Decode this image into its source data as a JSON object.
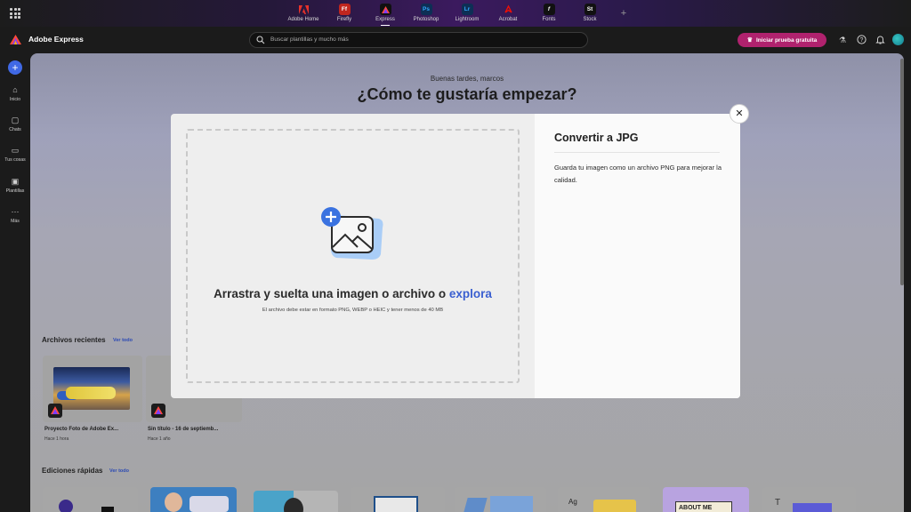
{
  "appbar": {
    "apps": [
      {
        "label": "Adobe Home",
        "tile": "",
        "color": "#1a1a1a"
      },
      {
        "label": "Firefly",
        "tile": "Ff",
        "color": "#c0261e"
      },
      {
        "label": "Express",
        "tile": "",
        "color": "#111111",
        "active": true
      },
      {
        "label": "Photoshop",
        "tile": "Ps",
        "color": "#0d2f55"
      },
      {
        "label": "Lightroom",
        "tile": "Lr",
        "color": "#0d2f55"
      },
      {
        "label": "Acrobat",
        "tile": "",
        "color": "#2a0a0a"
      },
      {
        "label": "Fonts",
        "tile": "f",
        "color": "#111111"
      },
      {
        "label": "Stock",
        "tile": "St",
        "color": "#111111"
      }
    ],
    "plus": "+"
  },
  "header": {
    "brand": "Adobe Express",
    "search_placeholder": "Buscar plantillas y mucho más",
    "trial_label": "Iniciar prueba gratuita",
    "icons": [
      "flask-icon",
      "help-icon",
      "bell-icon",
      "avatar"
    ]
  },
  "rail": {
    "items": [
      {
        "label": "Inicio",
        "icon": "⌂"
      },
      {
        "label": "Chats",
        "icon": "▢"
      },
      {
        "label": "Tus cosas",
        "icon": "▭"
      },
      {
        "label": "Plantillas",
        "icon": "▣"
      },
      {
        "label": "Más",
        "icon": "⋯"
      }
    ]
  },
  "main": {
    "greeting": "Buenas tardes, marcos",
    "headline": "¿Cómo te gustaría empezar?",
    "recent_title": "Archivos recientes",
    "recent_link": "Ver todo",
    "recent": [
      {
        "name": "Proyecto Foto de Adobe Ex...",
        "meta": "Hace 1 hora"
      },
      {
        "name": "Sin título - 16 de septiemb...",
        "meta": "Hace 1 año"
      }
    ],
    "quick_title": "Ediciones rápidas",
    "quick_link": "Ver todo",
    "quick_bits": [
      "Ag",
      "T",
      "ABOUT ME"
    ]
  },
  "modal": {
    "drop_title_prefix": "Arrastra y suelta una imagen o archivo o ",
    "drop_title_link": "explora",
    "drop_subtitle": "El archivo debe estar en formato PNG, WEBP o HEIC y tener menos de 40 MB",
    "side_title": "Convertir a JPG",
    "side_description": "Guarda tu imagen como un archivo PNG para mejorar la calidad.",
    "close": "✕"
  }
}
